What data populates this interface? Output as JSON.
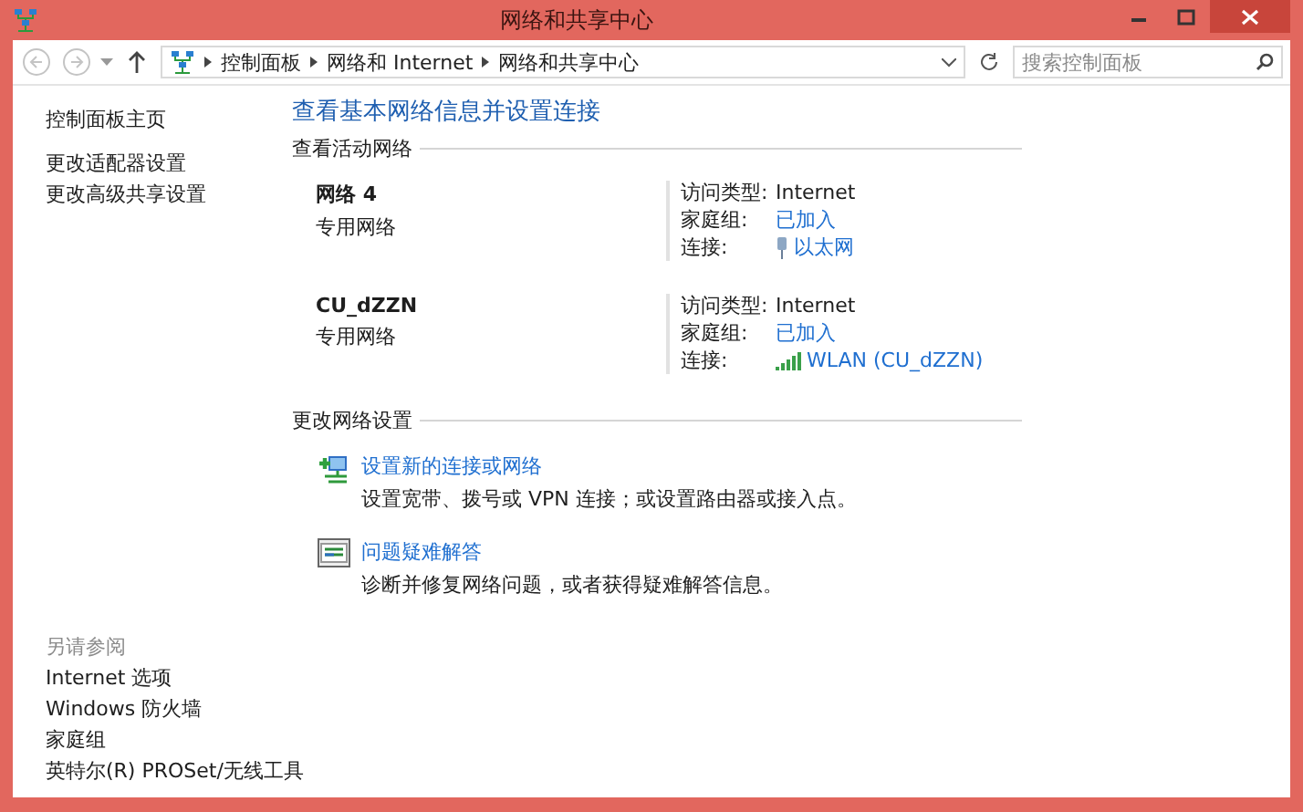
{
  "window": {
    "title": "网络和共享中心"
  },
  "nav": [
    {
      "kind": "back",
      "disabled": true
    },
    {
      "kind": "forward",
      "disabled": true
    },
    {
      "kind": "up",
      "disabled": false
    }
  ],
  "breadcrumbs": [
    "控制面板",
    "网络和 Internet",
    "网络和共享中心"
  ],
  "search": {
    "placeholder": "搜索控制面板"
  },
  "sidebar": {
    "links": [
      "控制面板主页",
      "更改适配器设置",
      "更改高级共享设置"
    ],
    "see_also_heading": "另请参阅",
    "see_also": [
      "Internet 选项",
      "Windows 防火墙",
      "家庭组",
      "英特尔(R) PROSet/无线工具"
    ]
  },
  "main": {
    "heading": "查看基本网络信息并设置连接",
    "active_heading": "查看活动网络",
    "networks": [
      {
        "name": "网络  4",
        "type": "专用网络",
        "access_label": "访问类型:",
        "access_value": "Internet",
        "homegroup_label": "家庭组:",
        "homegroup_value": "已加入",
        "connection_label": "连接:",
        "kind": "ethernet",
        "connection_value": "以太网"
      },
      {
        "name": "CU_dZZN",
        "type": "专用网络",
        "access_label": "访问类型:",
        "access_value": "Internet",
        "homegroup_label": "家庭组:",
        "homegroup_value": "已加入",
        "connection_label": "连接:",
        "kind": "wifi",
        "connection_value": "WLAN (CU_dZZN)"
      }
    ],
    "change_heading": "更改网络设置",
    "tasks": [
      {
        "kind": "new-connection",
        "title": "设置新的连接或网络",
        "description": "设置宽带、拨号或 VPN 连接；或设置路由器或接入点。"
      },
      {
        "kind": "troubleshoot",
        "title": "问题疑难解答",
        "description": "诊断并修复网络问题，或者获得疑难解答信息。"
      }
    ]
  }
}
